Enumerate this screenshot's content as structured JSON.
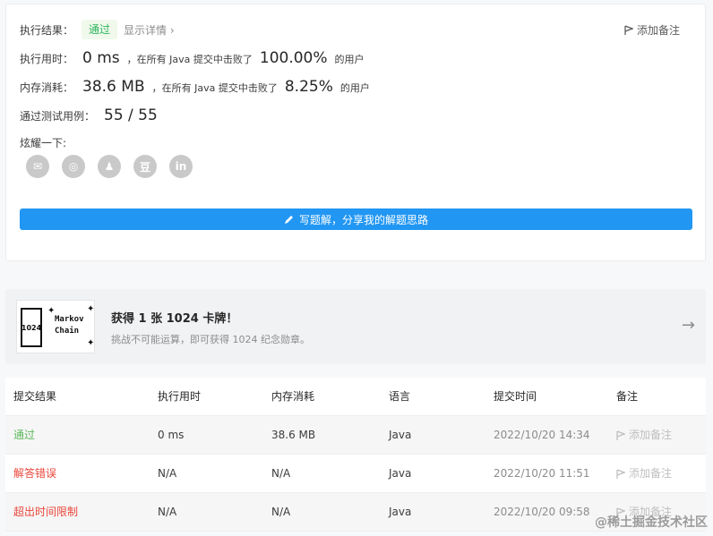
{
  "result": {
    "label": "执行结果：",
    "status": "通过",
    "details_link": "显示详情 ›",
    "add_note": "添加备注"
  },
  "runtime": {
    "label": "执行用时：",
    "value": "0 ms",
    "mid_text": "，在所有 Java 提交中击败了",
    "percent": "100.00%",
    "suffix": "的用户"
  },
  "memory": {
    "label": "内存消耗：",
    "value": "38.6 MB",
    "mid_text": "，在所有 Java 提交中击败了",
    "percent": "8.25%",
    "suffix": "的用户"
  },
  "tests": {
    "label": "通过测试用例：",
    "value": "55 / 55"
  },
  "share": {
    "label": "炫耀一下:",
    "icons": [
      "wechat-icon",
      "weibo-icon",
      "qq-icon",
      "douban-icon",
      "linkedin-icon"
    ],
    "glyphs": [
      "✉",
      "◎",
      "♟",
      "豆",
      "in"
    ]
  },
  "write_solution": "写题解，分享我的解题思路",
  "banner": {
    "badge_glyph": "1024",
    "badge_text_1": "Markov",
    "badge_text_2": "Chain",
    "title": "获得 1 张 1024 卡牌！",
    "subtitle": "挑战不可能运算，即可获得 1024 纪念勋章。",
    "arrow": "→"
  },
  "table": {
    "headers": [
      "提交结果",
      "执行用时",
      "内存消耗",
      "语言",
      "提交时间",
      "备注"
    ],
    "rows": [
      {
        "status": "通过",
        "runtime": "0 ms",
        "memory": "38.6 MB",
        "lang": "Java",
        "time": "2022/10/20 14:34",
        "note": "添加备注"
      },
      {
        "status": "解答错误",
        "runtime": "N/A",
        "memory": "N/A",
        "lang": "Java",
        "time": "2022/10/20 11:51",
        "note": "添加备注"
      },
      {
        "status": "超出时间限制",
        "runtime": "N/A",
        "memory": "N/A",
        "lang": "Java",
        "time": "2022/10/20 09:58",
        "note": "添加备注"
      }
    ]
  },
  "watermark": "@稀土掘金技术社区",
  "colors": {
    "accent": "#2196f3",
    "success": "#5cb85c",
    "error": "#e9463a"
  }
}
